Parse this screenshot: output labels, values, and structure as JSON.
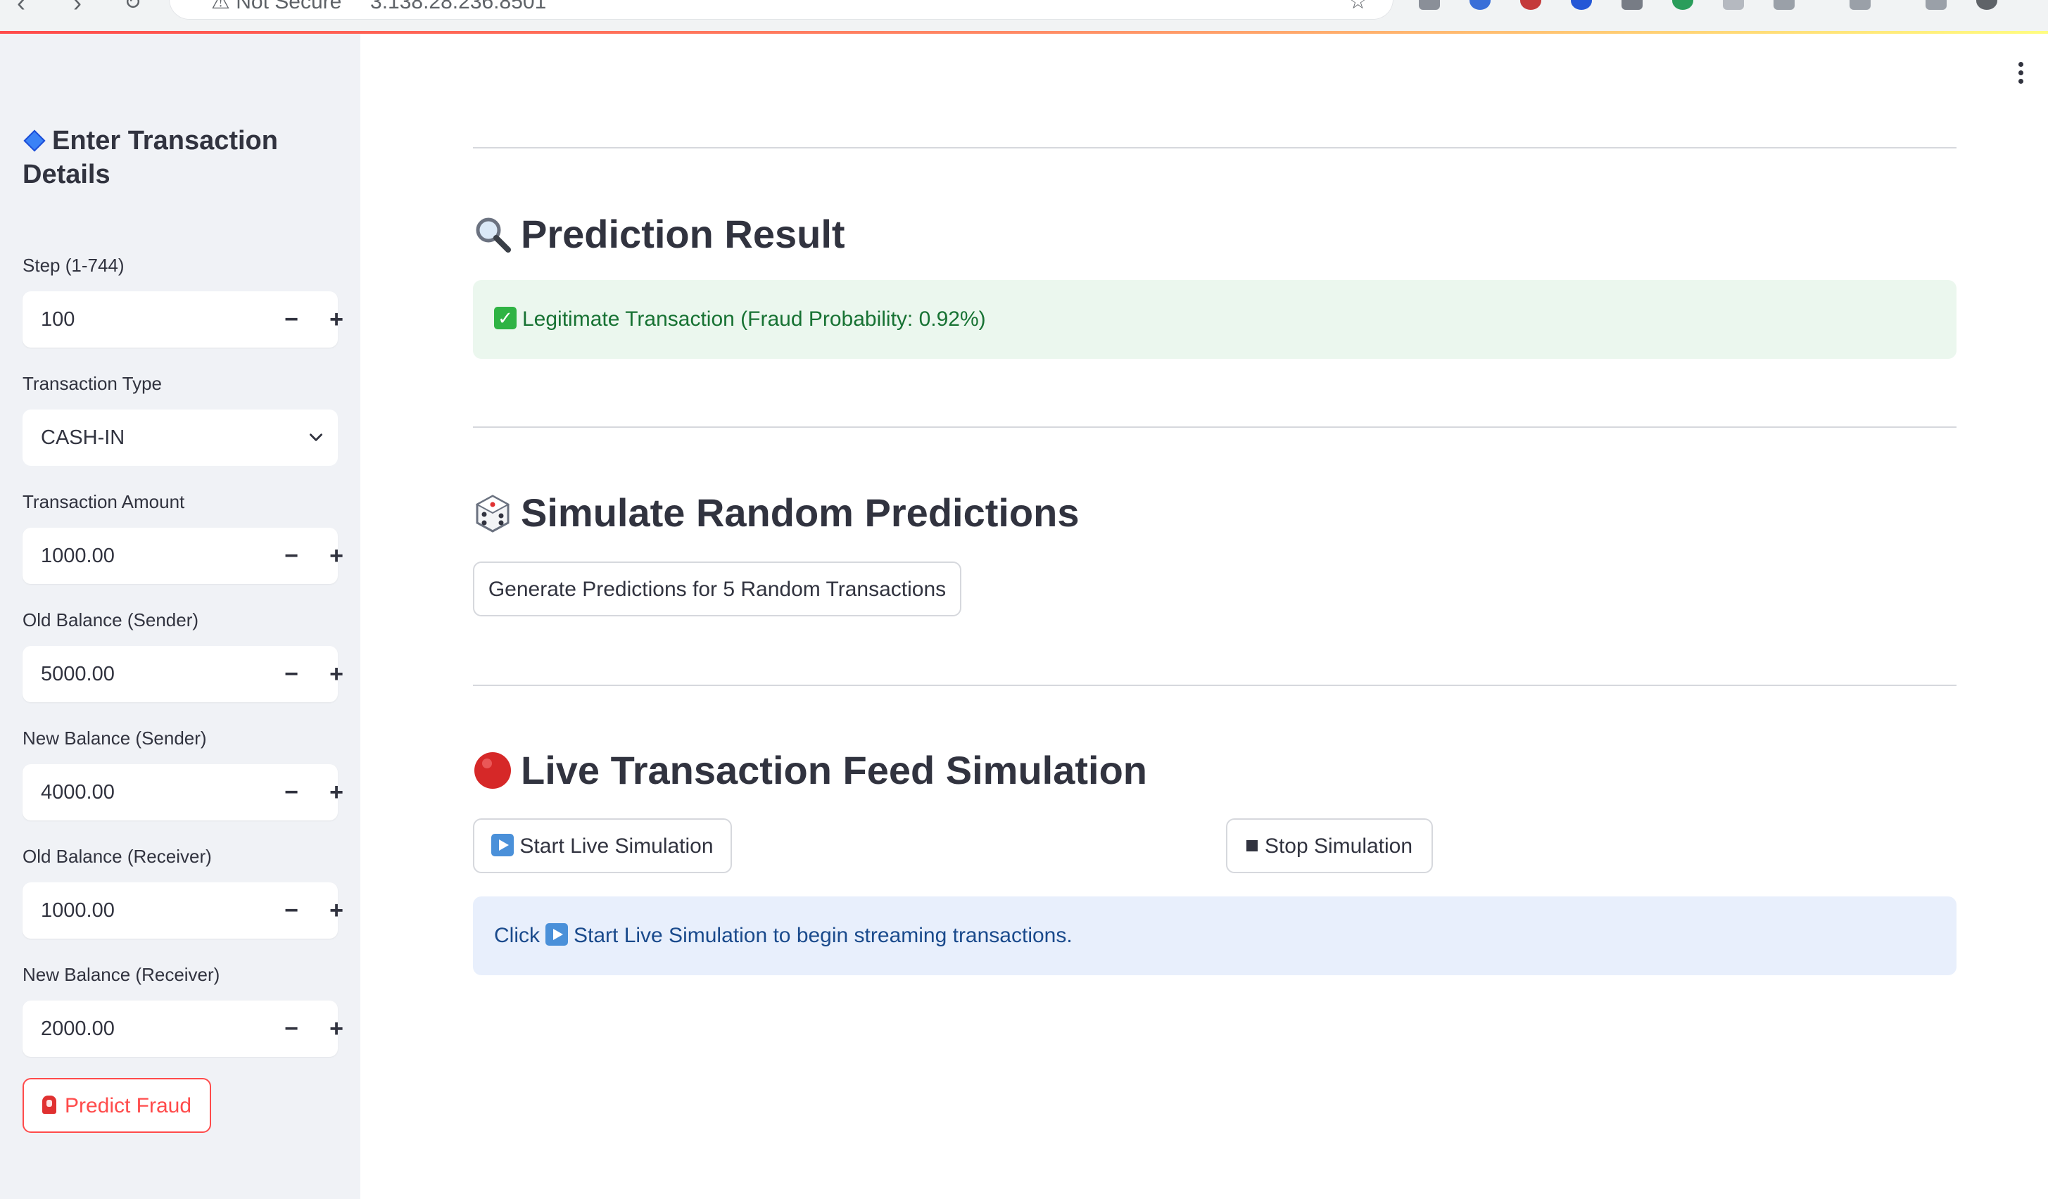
{
  "browser": {
    "address": "3.138.28.236:8501",
    "security_label": "Not Secure"
  },
  "sidebar": {
    "title": "Enter Transaction Details",
    "fields": [
      {
        "label": "Step (1-744)",
        "value": "100"
      },
      {
        "label": "Transaction Type",
        "value": "CASH-IN"
      },
      {
        "label": "Transaction Amount",
        "value": "1000.00"
      },
      {
        "label": "Old Balance (Sender)",
        "value": "5000.00"
      },
      {
        "label": "New Balance (Sender)",
        "value": "4000.00"
      },
      {
        "label": "Old Balance (Receiver)",
        "value": "1000.00"
      },
      {
        "label": "New Balance (Receiver)",
        "value": "2000.00"
      }
    ],
    "stepper_minus": "−",
    "stepper_plus": "+",
    "predict_button": "Predict Fraud"
  },
  "main": {
    "prediction": {
      "title": "Prediction Result",
      "result_text": "Legitimate Transaction (Fraud Probability: 0.92%)"
    },
    "simulate": {
      "title": "Simulate Random Predictions",
      "button": "Generate Predictions for 5 Random Transactions"
    },
    "live": {
      "title": "Live Transaction Feed Simulation",
      "start_button": "Start Live Simulation",
      "stop_button": "Stop Simulation",
      "info_prefix": "Click",
      "info_suffix": "Start Live Simulation to begin streaming transactions."
    }
  },
  "colors": {
    "primary": "#ff4b4b",
    "sidebar_bg": "#f0f2f6",
    "success_bg": "#ebf7ee",
    "success_text": "#177233",
    "info_bg": "#e8effc",
    "info_text": "#1a4a8c"
  }
}
